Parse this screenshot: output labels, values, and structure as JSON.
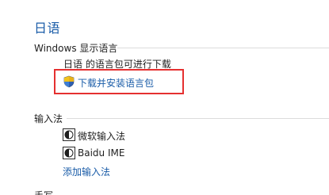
{
  "page": {
    "title": "日语"
  },
  "display_language": {
    "section_label": "Windows 显示语言",
    "status_text": "日语 的语言包可进行下载",
    "download_link": "下载并安装语言包",
    "download_icon": "uac-shield-icon"
  },
  "input_method": {
    "section_label": "输入法",
    "items": [
      {
        "label": "微软输入法",
        "icon": "microsoft-ime-icon"
      },
      {
        "label": "Baidu IME",
        "icon": "baidu-ime-icon"
      }
    ],
    "add_link": "添加输入法"
  },
  "next_section": {
    "section_label": "手写"
  },
  "colors": {
    "title": "#1a5ca8",
    "link": "#1a5ca8",
    "highlight_border": "#e53030"
  }
}
